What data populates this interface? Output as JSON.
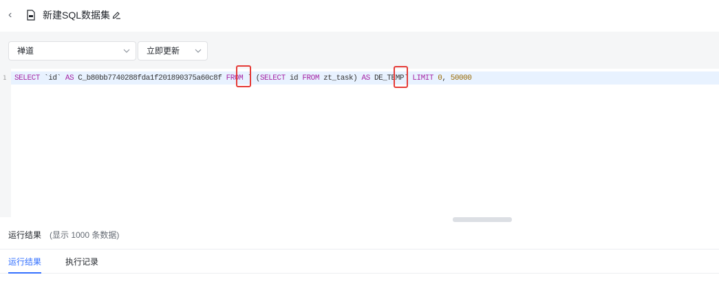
{
  "header": {
    "back_icon": "chevron-left-icon",
    "doc_icon": "sql-file-icon",
    "title": "新建SQL数据集",
    "edit_icon": "pencil-icon"
  },
  "toolbar": {
    "datasource": {
      "value": "禅道"
    },
    "update_mode": {
      "value": "立即更新"
    }
  },
  "editor": {
    "line_number": "1",
    "code_tokens": {
      "t1": "SELECT",
      "t2": " `id` ",
      "t3": "AS",
      "t4": " C_b80bb7740288fda1f201890375a60c8f ",
      "t5": "FROM",
      "t6": " ` (",
      "t7": "SELECT",
      "t8": " id ",
      "t9": "FROM",
      "t10": " zt_task) ",
      "t11": "AS",
      "t12": " DE_TEMP` ",
      "t13": "LIMIT",
      "t14": " ",
      "t15": "0",
      "t16": ", ",
      "t17": "50000"
    }
  },
  "results": {
    "title": "运行结果",
    "note": "(显示 1000 条数据)"
  },
  "tabs": {
    "result_tab": "运行结果",
    "log_tab": "执行记录"
  },
  "colors": {
    "accent": "#3370ff",
    "highlight_box": "#e53935",
    "keyword": "#a626a4"
  }
}
